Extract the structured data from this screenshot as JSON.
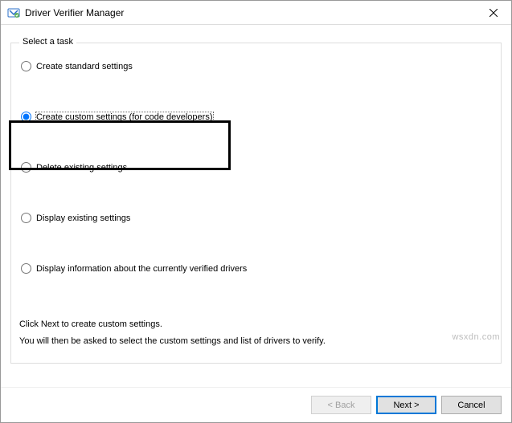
{
  "window": {
    "title": "Driver Verifier Manager"
  },
  "group": {
    "legend": "Select a task"
  },
  "options": {
    "create_standard": "Create standard settings",
    "create_custom": "Create custom settings (for code developers)",
    "delete_existing": "Delete existing settings",
    "display_existing": "Display existing settings",
    "display_info": "Display information about the currently verified drivers"
  },
  "info": {
    "line1": "Click Next to create custom settings.",
    "line2": "You will then be asked to select the custom settings and list of drivers to verify."
  },
  "buttons": {
    "back": "< Back",
    "next": "Next >",
    "cancel": "Cancel"
  },
  "watermark": "wsxdn.com"
}
